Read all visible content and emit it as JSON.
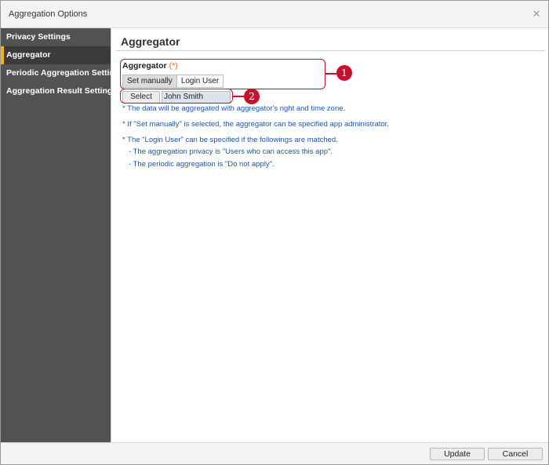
{
  "window": {
    "title": "Aggregation Options"
  },
  "sidebar": {
    "items": [
      {
        "label": "Privacy Settings"
      },
      {
        "label": "Aggregator"
      },
      {
        "label": "Periodic Aggregation Settings"
      },
      {
        "label": "Aggregation Result Settings"
      }
    ],
    "active_index": 1
  },
  "main": {
    "title": "Aggregator",
    "field_label": "Aggregator",
    "required_mark": "(*)",
    "mode_options": [
      "Set manually",
      "Login User"
    ],
    "selected_mode": "Set manually",
    "select_button": "Select",
    "selected_user": "John Smith",
    "notes": [
      "* The data will be aggregated with aggregator's right and time zone.",
      "* If \"Set manually\" is selected, the aggregator can be specified app administrator.",
      "* The \"Login User\" can be specified if the followings are matched.",
      "- The aggregation privacy is \"Users who can access this app\".",
      "- The periodic aggregation is \"Do not apply\"."
    ]
  },
  "annotations": [
    "1",
    "2"
  ],
  "footer": {
    "update_label": "Update",
    "cancel_label": "Cancel"
  },
  "colors": {
    "accent": "#f6b300",
    "sidebar": "#525252",
    "note_text": "#1f57a6",
    "required": "#e86a12",
    "annotation": "#c8102e"
  },
  "icons": {
    "close": "close-icon"
  }
}
